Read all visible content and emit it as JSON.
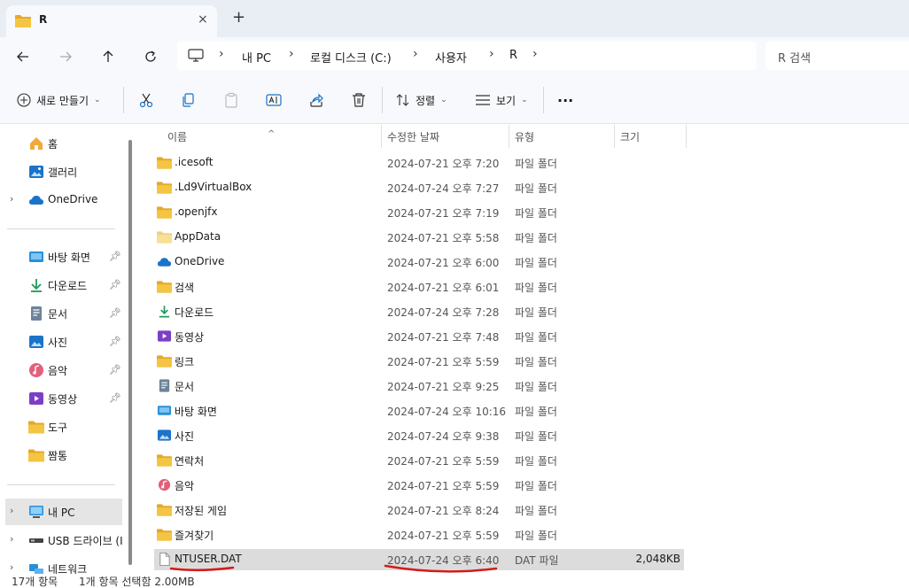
{
  "tab": {
    "title": "R",
    "close_icon": "×",
    "new_tab_icon": "+"
  },
  "address": {
    "breadcrumbs": [
      "내 PC",
      "로컬 디스크 (C:)",
      "사용자",
      "R"
    ],
    "search_placeholder": "R 검색"
  },
  "toolbar": {
    "new_label": "새로 만들기",
    "sort_label": "정렬",
    "view_label": "보기",
    "more_label": "···"
  },
  "sidebar": {
    "quick": [
      {
        "label": "홈",
        "icon": "home-icon"
      },
      {
        "label": "갤러리",
        "icon": "gallery-icon"
      },
      {
        "label": "OneDrive",
        "icon": "onedrive-icon"
      }
    ],
    "pinned": [
      {
        "label": "바탕 화면",
        "icon": "desktop-icon",
        "pinned": true
      },
      {
        "label": "다운로드",
        "icon": "download-icon",
        "pinned": true
      },
      {
        "label": "문서",
        "icon": "document-icon",
        "pinned": true
      },
      {
        "label": "사진",
        "icon": "pictures-icon",
        "pinned": true
      },
      {
        "label": "음악",
        "icon": "music-icon",
        "pinned": true
      },
      {
        "label": "동영상",
        "icon": "video-icon",
        "pinned": true
      },
      {
        "label": "도구",
        "icon": "folder-icon",
        "pinned": false
      },
      {
        "label": "짬통",
        "icon": "folder-icon",
        "pinned": false
      }
    ],
    "devices": [
      {
        "label": "내 PC",
        "icon": "pc-icon"
      },
      {
        "label": "USB 드라이브 (I",
        "icon": "usb-drive-icon"
      },
      {
        "label": "네트워크",
        "icon": "network-icon"
      }
    ]
  },
  "columns": {
    "name": "이름",
    "date": "수정한 날짜",
    "type": "유형",
    "size": "크기"
  },
  "files": [
    {
      "name": ".icesoft",
      "date": "2024-07-21 오후 7:20",
      "type": "파일 폴더",
      "size": "",
      "icon": "folder"
    },
    {
      "name": ".Ld9VirtualBox",
      "date": "2024-07-24 오후 7:27",
      "type": "파일 폴더",
      "size": "",
      "icon": "folder"
    },
    {
      "name": ".openjfx",
      "date": "2024-07-21 오후 7:19",
      "type": "파일 폴더",
      "size": "",
      "icon": "folder"
    },
    {
      "name": "AppData",
      "date": "2024-07-21 오후 5:58",
      "type": "파일 폴더",
      "size": "",
      "icon": "folder-hidden"
    },
    {
      "name": "OneDrive",
      "date": "2024-07-21 오후 6:00",
      "type": "파일 폴더",
      "size": "",
      "icon": "onedrive"
    },
    {
      "name": "검색",
      "date": "2024-07-21 오후 6:01",
      "type": "파일 폴더",
      "size": "",
      "icon": "folder"
    },
    {
      "name": "다운로드",
      "date": "2024-07-24 오후 7:28",
      "type": "파일 폴더",
      "size": "",
      "icon": "download"
    },
    {
      "name": "동영상",
      "date": "2024-07-21 오후 7:48",
      "type": "파일 폴더",
      "size": "",
      "icon": "video"
    },
    {
      "name": "링크",
      "date": "2024-07-21 오후 5:59",
      "type": "파일 폴더",
      "size": "",
      "icon": "folder"
    },
    {
      "name": "문서",
      "date": "2024-07-21 오후 9:25",
      "type": "파일 폴더",
      "size": "",
      "icon": "document"
    },
    {
      "name": "바탕 화면",
      "date": "2024-07-24 오후 10:16",
      "type": "파일 폴더",
      "size": "",
      "icon": "desktop"
    },
    {
      "name": "사진",
      "date": "2024-07-24 오후 9:38",
      "type": "파일 폴더",
      "size": "",
      "icon": "pictures"
    },
    {
      "name": "연락처",
      "date": "2024-07-21 오후 5:59",
      "type": "파일 폴더",
      "size": "",
      "icon": "folder"
    },
    {
      "name": "음악",
      "date": "2024-07-21 오후 5:59",
      "type": "파일 폴더",
      "size": "",
      "icon": "music"
    },
    {
      "name": "저장된 게임",
      "date": "2024-07-21 오후 8:24",
      "type": "파일 폴더",
      "size": "",
      "icon": "folder"
    },
    {
      "name": "즐겨찾기",
      "date": "2024-07-21 오후 5:59",
      "type": "파일 폴더",
      "size": "",
      "icon": "folder"
    },
    {
      "name": "NTUSER.DAT",
      "date": "2024-07-24 오후 6:40",
      "type": "DAT 파일",
      "size": "2,048KB",
      "icon": "file",
      "selected": true
    }
  ],
  "status": {
    "count": "17개 항목",
    "selection": "1개 항목 선택함 2.00MB"
  },
  "colors": {
    "folder": "#f4c542",
    "folder_dark": "#e3a92b",
    "accent_blue": "#1a73c9",
    "annotation_red": "#d61a1a",
    "selected_row": "#dcdcdc"
  }
}
